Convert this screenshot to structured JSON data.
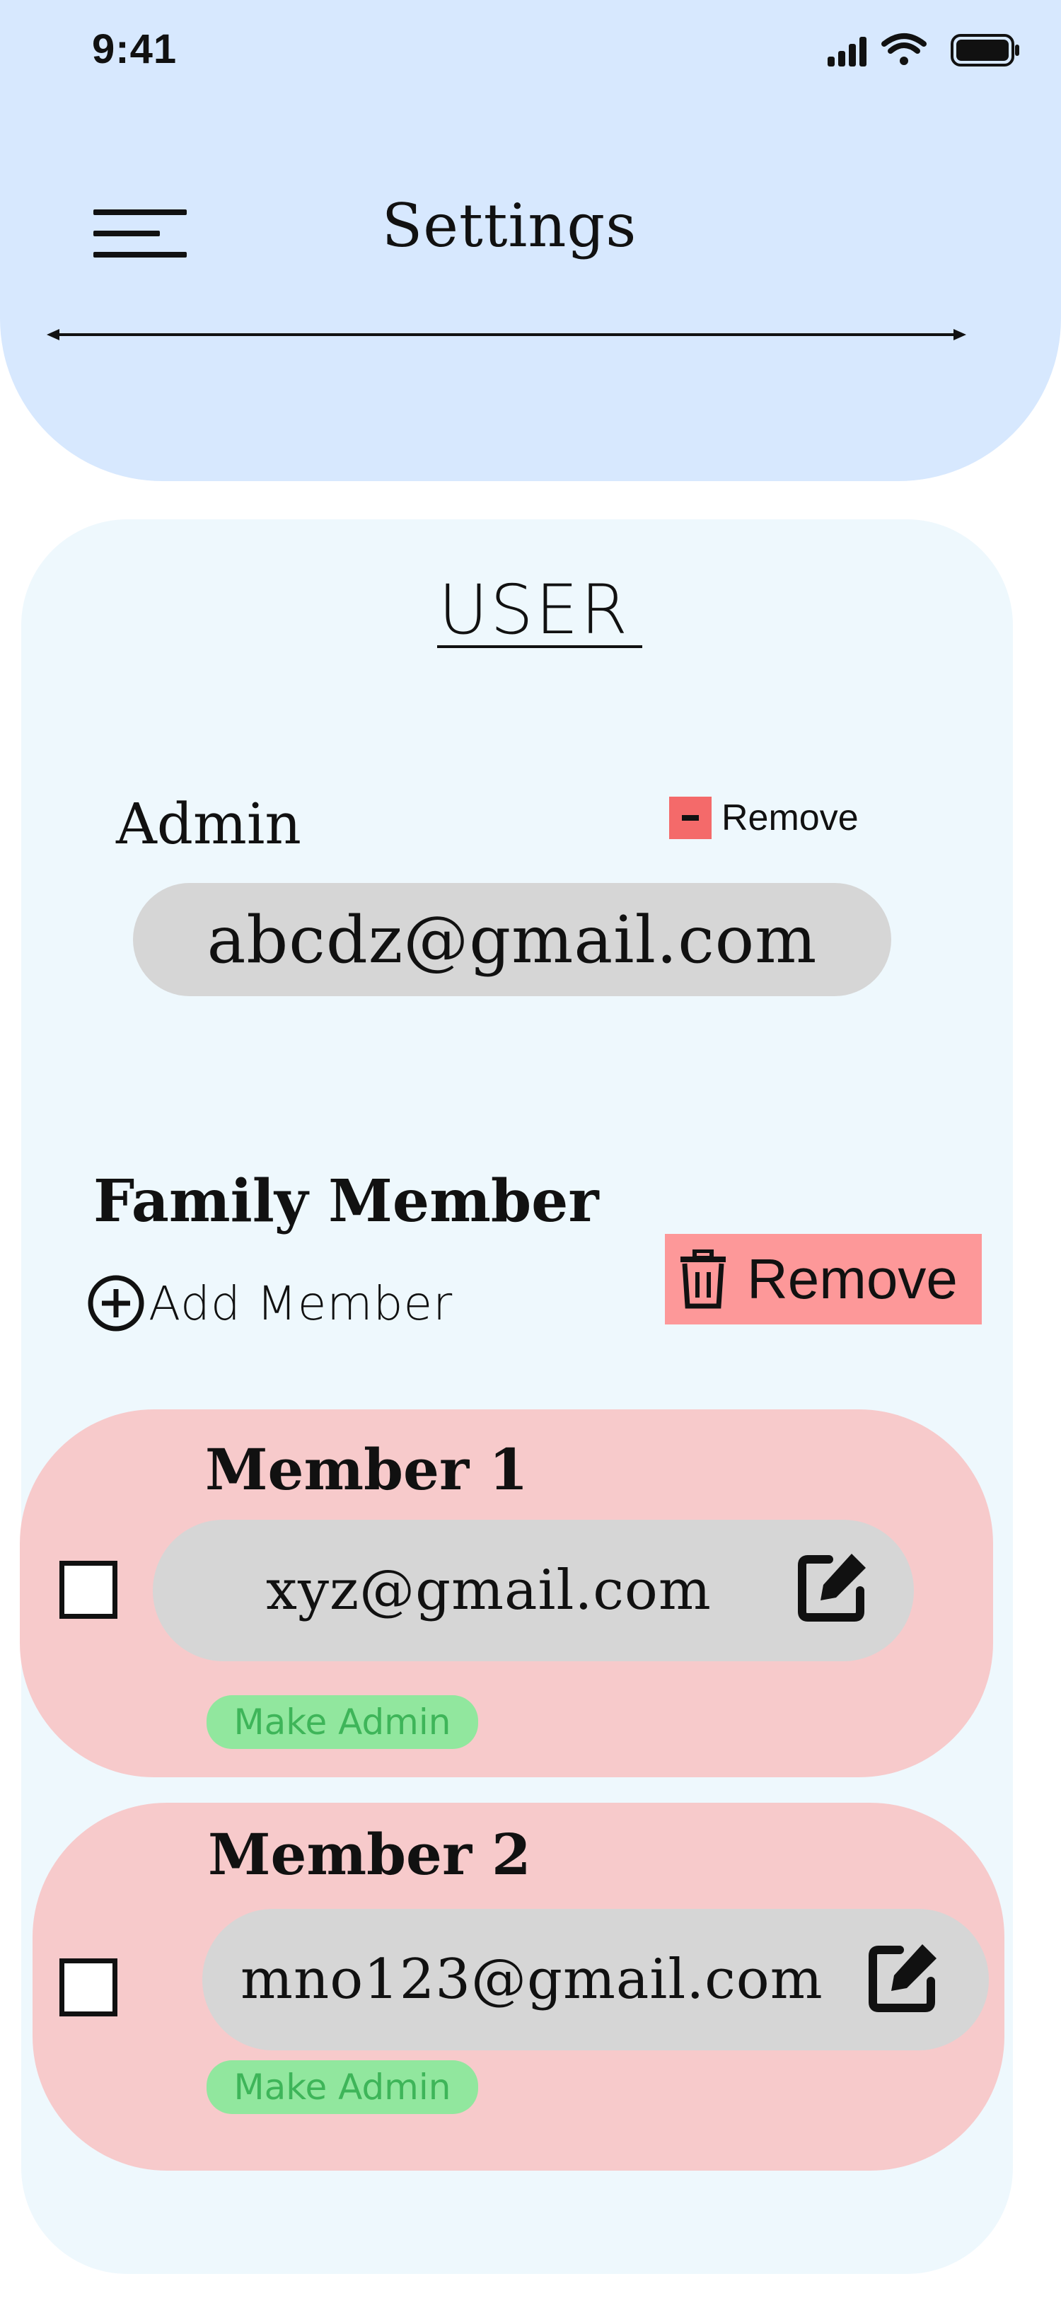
{
  "status_bar": {
    "time": "9:41"
  },
  "header": {
    "title": "Settings"
  },
  "section": {
    "title": "USER"
  },
  "admin": {
    "label": "Admin",
    "remove_label": "Remove",
    "email": "abcdz@gmail.com"
  },
  "family": {
    "label": "Family Member",
    "add_label": "Add Member",
    "remove_label": "Remove",
    "members": [
      {
        "name": "Member 1",
        "email": "xyz@gmail.com",
        "action_label": "Make Admin",
        "checked": false
      },
      {
        "name": "Member 2",
        "email": "mno123@gmail.com",
        "action_label": "Make Admin",
        "checked": false
      }
    ]
  },
  "colors": {
    "header_bg": "#d7e8fe",
    "panel_bg": "#eef8fd",
    "card_bg": "#f7cacb",
    "pill_bg": "#d6d6d6",
    "remove_bg": "#fd9899",
    "make_admin_bg": "#91e79e",
    "make_admin_text": "#3eb559"
  },
  "icons": {
    "menu": "menu-lines-icon",
    "add": "plus-circle-icon",
    "trash": "trash-icon",
    "minus": "minus-box-icon",
    "edit": "edit-square-icon"
  }
}
